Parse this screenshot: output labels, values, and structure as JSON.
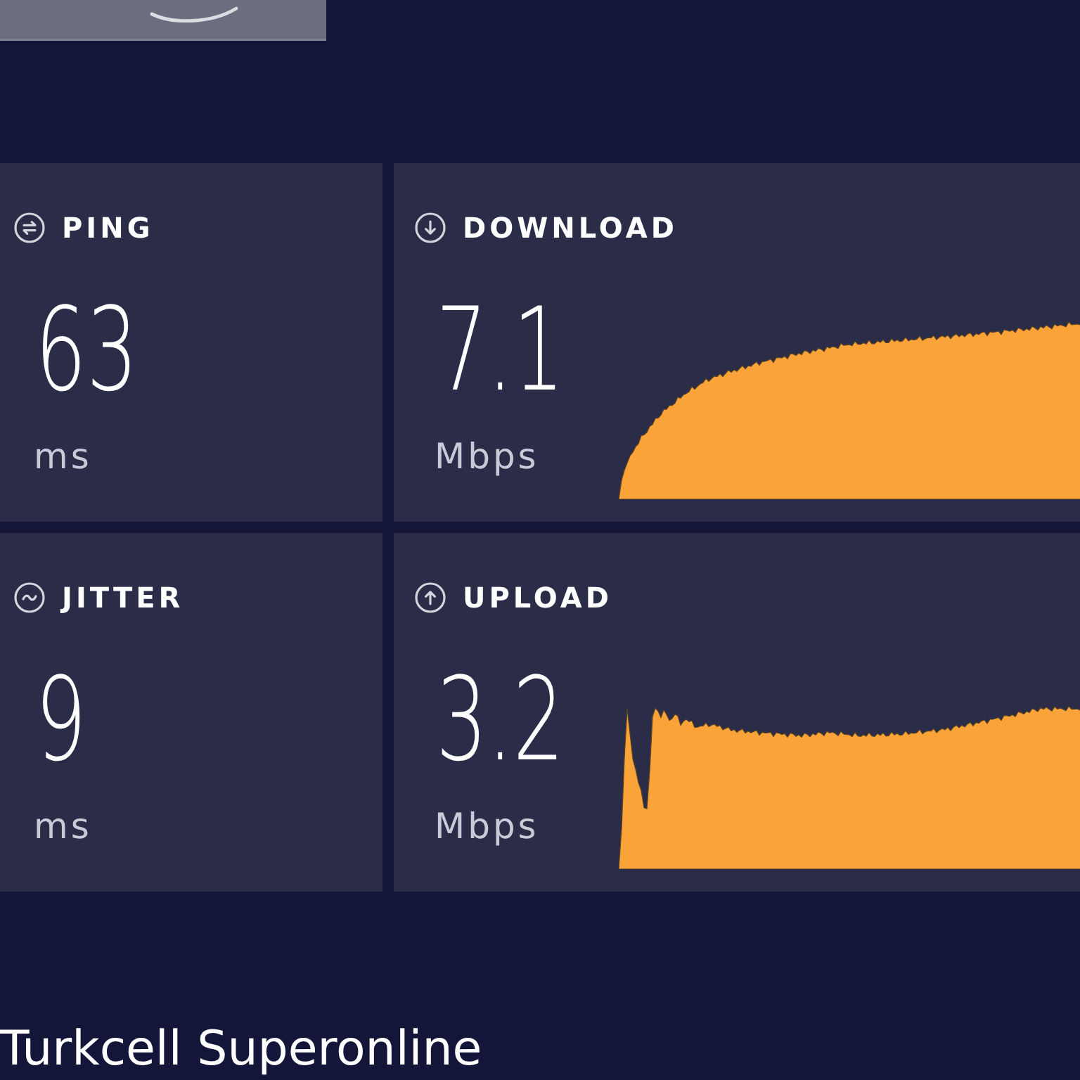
{
  "metrics": [
    {
      "kind": "ping",
      "label": "PING",
      "value": "63",
      "unit": "ms"
    },
    {
      "kind": "download",
      "label": "DOWNLOAD",
      "value": "7.1",
      "unit": "Mbps"
    },
    {
      "kind": "jitter",
      "label": "JITTER",
      "value": "9",
      "unit": "ms"
    },
    {
      "kind": "upload",
      "label": "UPLOAD",
      "value": "3.2",
      "unit": "Mbps"
    }
  ],
  "provider": "Turkcell Superonline"
}
